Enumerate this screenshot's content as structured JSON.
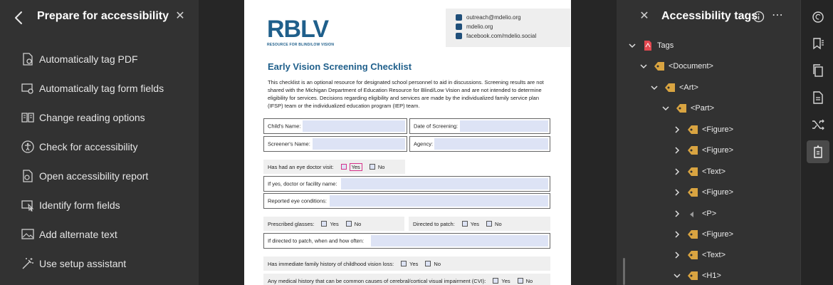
{
  "left_panel": {
    "title": "Prepare for accessibility",
    "tools": [
      {
        "label": "Automatically tag PDF",
        "icon": "auto-tag-pdf-icon"
      },
      {
        "label": "Automatically tag form fields",
        "icon": "auto-tag-form-icon"
      },
      {
        "label": "Change reading options",
        "icon": "reading-options-icon"
      },
      {
        "label": "Check for accessibility",
        "icon": "accessibility-check-icon"
      },
      {
        "label": "Open accessibility report",
        "icon": "accessibility-report-icon"
      },
      {
        "label": "Identify form fields",
        "icon": "identify-form-fields-icon"
      },
      {
        "label": "Add alternate text",
        "icon": "alt-text-icon"
      },
      {
        "label": "Use setup assistant",
        "icon": "setup-assistant-icon"
      }
    ]
  },
  "document": {
    "logo": "RBLV",
    "logo_sub": "RESOURCE FOR BLIND/LOW VISION",
    "contact": [
      "outreach@mdelio.org",
      "mdelio.org",
      "facebook.com/mdelio.social"
    ],
    "title": "Early Vision Screening Checklist",
    "intro": "This checklist is an optional resource for designated school personnel to aid in discussions. Screening results are not shared with the Michigan Department of Education Resource for Blind/Low Vision and are not intended to determine eligibility for services. Decisions regarding eligibility and services are made by the individualized family service plan (IFSP) team or the individualized education program (IEP) team.",
    "fields": {
      "child_name": "Child's Name:",
      "date_screening": "Date of Screening:",
      "screener_name": "Screener's Name:",
      "agency": "Agency:",
      "eye_doctor": "Has had an eye doctor visit:",
      "yes": "Yes",
      "no": "No",
      "doctor_name": "If yes, doctor or facility name:",
      "eye_conditions": "Reported eye conditions:",
      "glasses": "Prescribed glasses:",
      "patch": "Directed to patch:",
      "patch_when": "If directed to patch, when and how often:",
      "family_history": "Has immediate family history of childhood vision loss:",
      "cvi": "Any medical history that can be common causes of cerebral/cortical visual impairment (CVI):"
    }
  },
  "right_panel": {
    "title": "Accessibility tags",
    "tree": [
      {
        "label": "Tags",
        "level": 0,
        "expanded": true,
        "icon": "pdf-icon"
      },
      {
        "label": "<Document>",
        "level": 1,
        "expanded": true,
        "icon": "tag-icon"
      },
      {
        "label": "<Art>",
        "level": 2,
        "expanded": true,
        "icon": "tag-icon"
      },
      {
        "label": "<Part>",
        "level": 3,
        "expanded": true,
        "icon": "tag-icon"
      },
      {
        "label": "<Figure>",
        "level": 4,
        "expanded": false,
        "icon": "tag-icon"
      },
      {
        "label": "<Figure>",
        "level": 4,
        "expanded": false,
        "icon": "tag-icon"
      },
      {
        "label": "<Text>",
        "level": 4,
        "expanded": false,
        "icon": "tag-icon"
      },
      {
        "label": "<Figure>",
        "level": 4,
        "expanded": false,
        "icon": "tag-icon"
      },
      {
        "label": "<P>",
        "level": 4,
        "expanded": false,
        "icon": "content-icon"
      },
      {
        "label": "<Figure>",
        "level": 4,
        "expanded": false,
        "icon": "tag-icon"
      },
      {
        "label": "<Text>",
        "level": 4,
        "expanded": false,
        "icon": "tag-icon"
      },
      {
        "label": "<H1>",
        "level": 4,
        "expanded": true,
        "icon": "tag-icon"
      }
    ]
  },
  "rail": [
    {
      "icon": "comment-icon",
      "active": false
    },
    {
      "icon": "bookmark-icon",
      "active": false
    },
    {
      "icon": "pages-icon",
      "active": false
    },
    {
      "icon": "document-icon",
      "active": false
    },
    {
      "icon": "order-icon",
      "active": false
    },
    {
      "icon": "tags-panel-icon",
      "active": true
    }
  ]
}
